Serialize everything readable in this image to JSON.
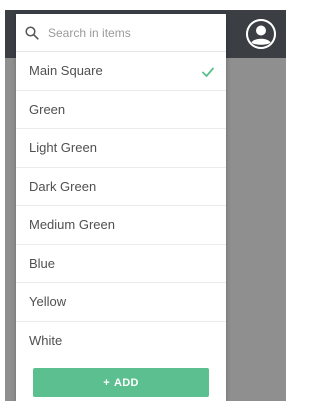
{
  "search": {
    "placeholder": "Search in items",
    "value": ""
  },
  "items": [
    {
      "label": "Main Square",
      "selected": true
    },
    {
      "label": "Green",
      "selected": false
    },
    {
      "label": "Light Green",
      "selected": false
    },
    {
      "label": "Dark Green",
      "selected": false
    },
    {
      "label": "Medium Green",
      "selected": false
    },
    {
      "label": "Blue",
      "selected": false
    },
    {
      "label": "Yellow",
      "selected": false
    },
    {
      "label": "White",
      "selected": false
    }
  ],
  "add_button": {
    "icon": "+",
    "label": "ADD"
  },
  "colors": {
    "accent": "#5bbf8f",
    "topbar": "#3b3f44",
    "backdrop": "#8f8f8f"
  },
  "icons": {
    "search": "search-icon",
    "check": "check-icon",
    "avatar": "user-avatar-icon"
  }
}
